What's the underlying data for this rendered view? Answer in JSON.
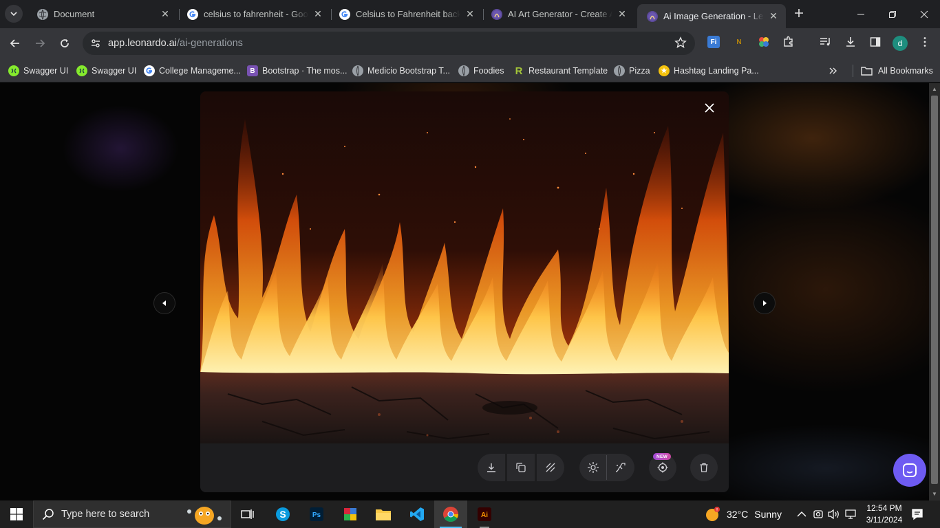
{
  "browser": {
    "tabs": [
      {
        "title": "Document",
        "favicon": "globe-icon",
        "active": false
      },
      {
        "title": "celsius to fahrenheit - Google Search",
        "favicon": "google-icon",
        "active": false
      },
      {
        "title": "Celsius to Fahrenheit background",
        "favicon": "google-icon",
        "active": false
      },
      {
        "title": "AI Art Generator - Create Art",
        "favicon": "leonardo-icon",
        "active": false
      },
      {
        "title": "Ai Image Generation - Leonardo",
        "favicon": "leonardo-icon",
        "active": true
      }
    ],
    "url_host": "app.leonardo.ai",
    "url_path": "/ai-generations",
    "profile_initial": "d"
  },
  "bookmarks": {
    "items": [
      {
        "label": "Swagger UI",
        "icon": "swagger-icon"
      },
      {
        "label": "Swagger UI",
        "icon": "swagger-icon"
      },
      {
        "label": "College Manageme...",
        "icon": "google-icon"
      },
      {
        "label": "Bootstrap · The mos...",
        "icon": "bootstrap-icon"
      },
      {
        "label": "Medicio Bootstrap T...",
        "icon": "globe-icon"
      },
      {
        "label": "Foodies",
        "icon": "globe-icon"
      },
      {
        "label": "Restaurant Template",
        "icon": "r-icon"
      },
      {
        "label": "Pizza",
        "icon": "globe-icon"
      },
      {
        "label": "Hashtag Landing Pa...",
        "icon": "star-badge-icon"
      }
    ],
    "all_bookmarks_label": "All Bookmarks"
  },
  "viewer": {
    "badge_new": "NEW",
    "actions": [
      "download-icon",
      "copy-icon",
      "remove-background-icon",
      "upscale-icon",
      "unzoom-icon",
      "motion-icon",
      "delete-icon"
    ]
  },
  "taskbar": {
    "search_placeholder": "Type here to search",
    "weather_temp": "32°C",
    "weather_desc": "Sunny",
    "time": "12:54 PM",
    "date": "3/11/2024"
  },
  "colors": {
    "tabstrip": "#1f2023",
    "toolbar": "#35363a",
    "accent_chat": "#6e5bf2",
    "taskbar": "#202020"
  }
}
